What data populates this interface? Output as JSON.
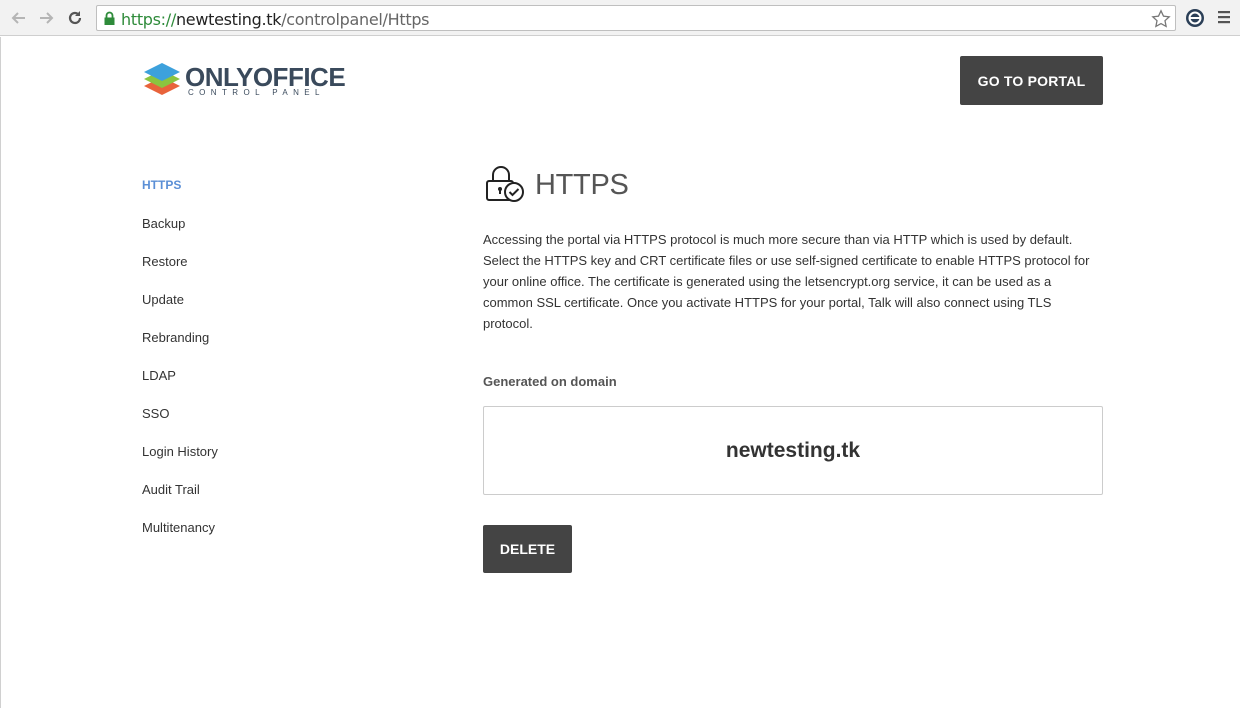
{
  "browser": {
    "url_scheme": "https://",
    "url_host": "newtesting.tk",
    "url_path": "/controlpanel/Https",
    "icons": [
      "back-arrow-icon",
      "forward-arrow-icon",
      "reload-icon",
      "lock-icon",
      "bookmark-star-icon",
      "extension-icon",
      "menu-icon"
    ]
  },
  "header": {
    "logo_text": "ONLYOFFICE",
    "logo_subtitle": "CONTROL PANEL",
    "portal_button": "GO TO PORTAL"
  },
  "sidebar": {
    "items": [
      {
        "label": "HTTPS",
        "active": true
      },
      {
        "label": "Backup"
      },
      {
        "label": "Restore"
      },
      {
        "label": "Update"
      },
      {
        "label": "Rebranding"
      },
      {
        "label": "LDAP"
      },
      {
        "label": "SSO"
      },
      {
        "label": "Login History"
      },
      {
        "label": "Audit Trail"
      },
      {
        "label": "Multitenancy"
      }
    ]
  },
  "main": {
    "title": "HTTPS",
    "title_icon": "padlock-check-icon",
    "description": "Accessing the portal via HTTPS protocol is much more secure than via HTTP which is used by default. Select the HTTPS key and CRT certificate files or use self-signed certificate to enable HTTPS protocol for your online office. The certificate is generated using the letsencrypt.org service, it can be used as a common SSL certificate. Once you activate HTTPS for your portal, Talk will also connect using TLS protocol.",
    "domain_label": "Generated on domain",
    "domain_value": "newtesting.tk",
    "delete_button": "DELETE"
  },
  "colors": {
    "accent": "#5b8fd6",
    "button_bg": "#444444",
    "secure_green": "#2e8b3a"
  }
}
